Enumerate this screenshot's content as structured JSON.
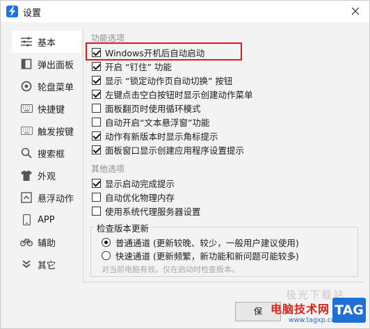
{
  "window": {
    "title": "设置"
  },
  "sidebar": {
    "items": [
      {
        "label": "基本",
        "icon": "sliders-icon",
        "active": true
      },
      {
        "label": "弹出面板",
        "icon": "panel-icon"
      },
      {
        "label": "轮盘菜单",
        "icon": "wheel-icon"
      },
      {
        "label": "快捷键",
        "icon": "keyboard-icon"
      },
      {
        "label": "触发按键",
        "icon": "trigger-keyboard-icon"
      },
      {
        "label": "搜索框",
        "icon": "search-icon"
      },
      {
        "label": "外观",
        "icon": "shirt-icon"
      },
      {
        "label": "悬浮动作",
        "icon": "float-icon"
      },
      {
        "label": "APP",
        "icon": "phone-icon"
      },
      {
        "label": "辅助",
        "icon": "bicycle-icon"
      },
      {
        "label": "其它",
        "icon": "chevrons-icon"
      }
    ]
  },
  "function_options": {
    "title": "功能选项",
    "items": [
      {
        "label": "Windows开机后自动启动",
        "checked": true
      },
      {
        "label": "开启 “钉住” 功能",
        "checked": true
      },
      {
        "label": "显示 “锁定动作页自动切换” 按钮",
        "checked": true
      },
      {
        "label": "左键点击空白按钮时显示创建动作菜单",
        "checked": true
      },
      {
        "label": "面板翻页时使用循环模式",
        "checked": false
      },
      {
        "label": "自动开启“文本悬浮窗”功能",
        "checked": false
      },
      {
        "label": "动作有新版本时显示角标提示",
        "checked": true
      },
      {
        "label": "面板窗口显示创建应用程序设置提示",
        "checked": true
      }
    ]
  },
  "other_options": {
    "title": "其他选项",
    "items": [
      {
        "label": "显示启动完成提示",
        "checked": true
      },
      {
        "label": "自动优化物理内存",
        "checked": false
      },
      {
        "label": "使用系统代理服务器设置",
        "checked": false
      }
    ]
  },
  "update_check": {
    "title": "检查版本更新",
    "options": [
      {
        "label": "普通通道 (更新较晚、较少，一般用户建议使用)",
        "selected": true
      },
      {
        "label": "快速通道 (更新频繁，新功能和新问题可能较多)",
        "selected": false
      }
    ],
    "note": "对当前电脑有效。仅在启动时检查版本。"
  },
  "footer": {
    "save_label": "保"
  },
  "watermark": {
    "site_name": "电脑技术网",
    "url": "www.tagxp.com",
    "tag": "TAG",
    "faint": "极光下载站"
  },
  "colors": {
    "highlight": "#e0161b",
    "accent": "#1a73e8",
    "watermark_blue": "#1f6fd6"
  }
}
